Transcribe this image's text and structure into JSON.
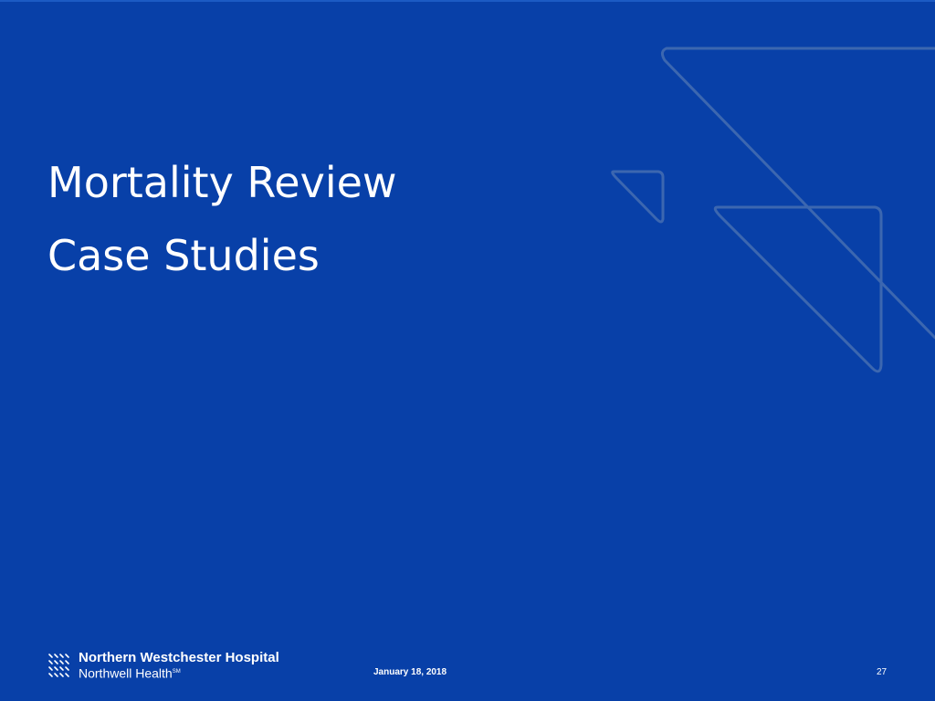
{
  "slide": {
    "title_line1": "Mortality Review",
    "title_line2": "Case Studies",
    "background_color": "#0840a8"
  },
  "footer": {
    "hospital_name": "Northern Westchester Hospital",
    "network_name": "Northwell Health",
    "network_mark": "SM",
    "date": "January 18, 2018",
    "page_number": "27"
  },
  "decoration": {
    "icon": "triangle-outline-decoration",
    "stroke_color": "#3c67b0"
  }
}
